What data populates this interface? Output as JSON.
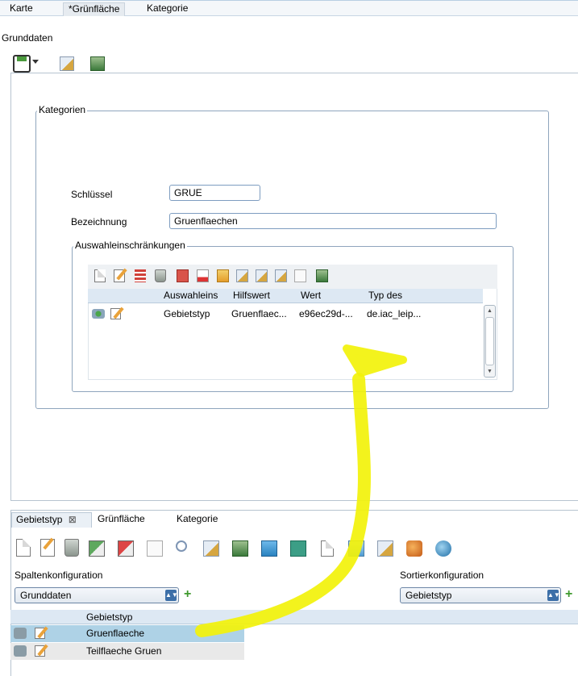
{
  "top_tabs": [
    "Karte",
    "*Grünfläche",
    "Kategorie"
  ],
  "section_title": "Grunddaten",
  "kategorien": {
    "legend": "Kategorien",
    "schluessel_label": "Schlüssel",
    "schluessel_value": "GRUE",
    "bezeichnung_label": "Bezeichnung",
    "bezeichnung_value": "Gruenflaechen"
  },
  "auswahl": {
    "legend": "Auswahleinschränkungen",
    "columns": [
      "Auswahleins",
      "Hilfswert",
      "Wert",
      "Typ des"
    ],
    "rows": [
      [
        "Gebietstyp",
        "Gruenflaec...",
        "e96ec29d-...",
        "de.iac_leip..."
      ]
    ]
  },
  "bottom": {
    "tabs": [
      "Gebietstyp",
      "Grünfläche",
      "Kategorie"
    ],
    "spalten_label": "Spaltenkonfiguration",
    "spalten_value": "Grunddaten",
    "sortier_label": "Sortierkonfiguration",
    "sortier_value": "Gebietstyp",
    "column_header": "Gebietstyp",
    "rows": [
      "Gruenflaeche",
      "Teilflaeche Gruen"
    ]
  },
  "colors": {
    "annotation_arrow": "#f2f20a",
    "selected_row": "#aed2e6",
    "header_bg": "#dde8f3"
  }
}
